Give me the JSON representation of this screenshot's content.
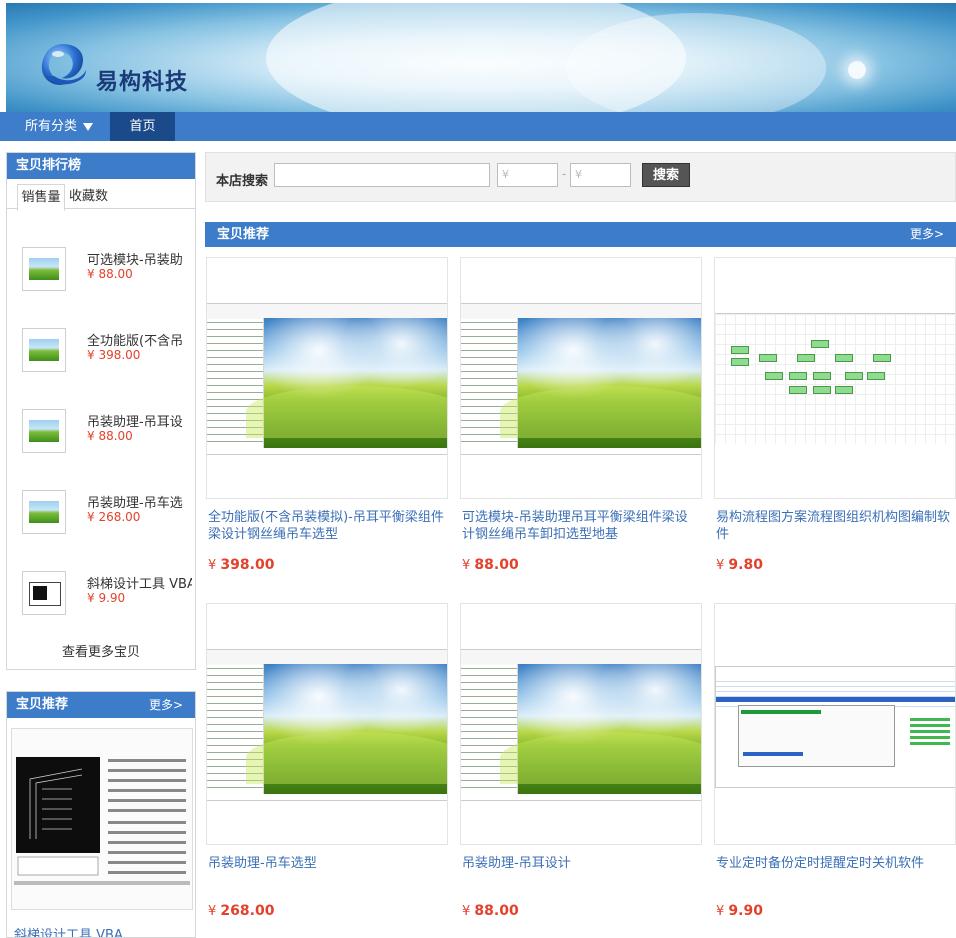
{
  "header": {
    "brand": "易构科技"
  },
  "nav": {
    "category_label": "所有分类",
    "home_label": "首页"
  },
  "rank": {
    "title": "宝贝排行榜",
    "tabs": [
      "销售量",
      "收藏数"
    ],
    "items": [
      {
        "title": "可选模块-吊装助",
        "price": "¥ 88.00"
      },
      {
        "title": "全功能版(不含吊",
        "price": "¥ 398.00"
      },
      {
        "title": "吊装助理-吊耳设",
        "price": "¥ 88.00"
      },
      {
        "title": "吊装助理-吊车选",
        "price": "¥ 268.00"
      },
      {
        "title": "斜梯设计工具 VBA",
        "price": "¥ 9.90"
      }
    ],
    "more_label": "查看更多宝贝"
  },
  "left_recommend": {
    "title": "宝贝推荐",
    "more": "更多>",
    "caption": "斜梯设计工具 VBA"
  },
  "search": {
    "label": "本店搜索",
    "min_placeholder": "¥",
    "max_placeholder": "¥",
    "separator": "-",
    "button": "搜索"
  },
  "main": {
    "title": "宝贝推荐",
    "more": "更多>",
    "products": [
      {
        "title": "全功能版(不含吊装模拟)-吊耳平衡梁组件梁设计钢丝绳吊车选型",
        "currency": "¥",
        "price": "398.00"
      },
      {
        "title": "可选模块-吊装助理吊耳平衡梁组件梁设计钢丝绳吊车卸扣选型地基",
        "currency": "¥",
        "price": "88.00"
      },
      {
        "title": "易构流程图方案流程图组织机构图编制软件",
        "currency": "¥",
        "price": "9.80"
      },
      {
        "title": "吊装助理-吊车选型",
        "currency": "¥",
        "price": "268.00"
      },
      {
        "title": "吊装助理-吊耳设计",
        "currency": "¥",
        "price": "88.00"
      },
      {
        "title": "专业定时备份定时提醒定时关机软件",
        "currency": "¥",
        "price": "9.90"
      }
    ]
  },
  "colors": {
    "nav_blue": "#3d7cc9",
    "nav_dark": "#1b4a8a",
    "price_red": "#e4412c",
    "link_blue": "#3b6fb6"
  }
}
